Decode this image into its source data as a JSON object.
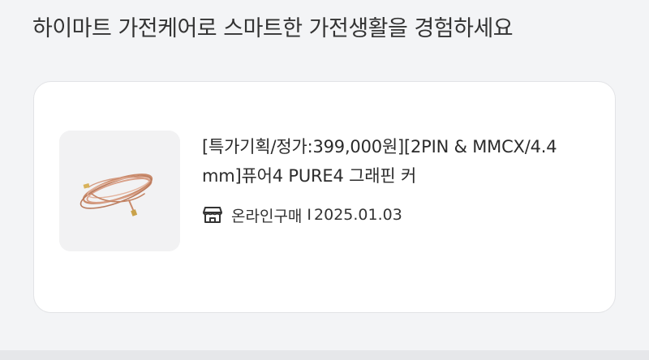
{
  "headline": "하이마트 가전케어로 스마트한 가전생활을 경험하세요",
  "product": {
    "title": "[특가기획/정가:399,000원][2PIN & MMCX/4.4 mm]퓨어4 PURE4 그래핀 커",
    "image_alt": "copper braided earphone cable",
    "store_type": "온라인구매",
    "separator": "I",
    "date": "2025.01.03"
  },
  "icons": {
    "store": "store-icon"
  },
  "colors": {
    "background": "#f3f4f6",
    "card": "#ffffff",
    "cable": "#c98a6a"
  }
}
